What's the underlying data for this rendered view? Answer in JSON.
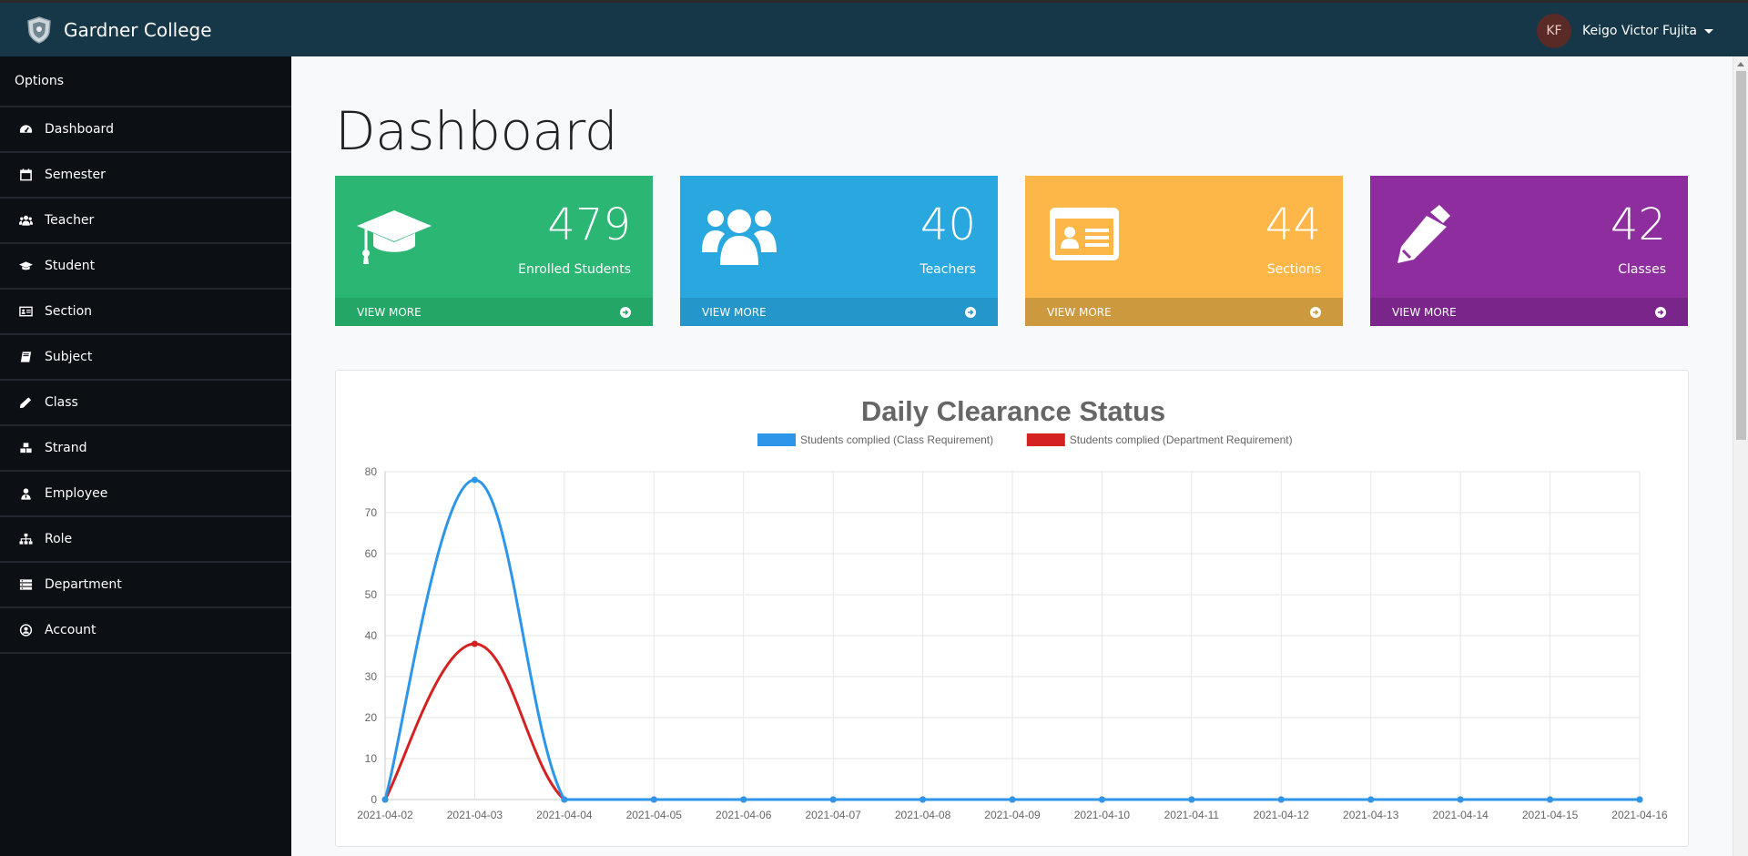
{
  "app": {
    "brand": "Gardner College",
    "logo_icon": "shield-crest-icon"
  },
  "user": {
    "initials": "KF",
    "name": "Keigo Victor Fujita"
  },
  "sidebar": {
    "title": "Options",
    "items": [
      {
        "label": "Dashboard",
        "icon": "tachometer-icon"
      },
      {
        "label": "Semester",
        "icon": "calendar-icon"
      },
      {
        "label": "Teacher",
        "icon": "users-icon"
      },
      {
        "label": "Student",
        "icon": "graduation-cap-icon"
      },
      {
        "label": "Section",
        "icon": "id-card-icon"
      },
      {
        "label": "Subject",
        "icon": "book-icon"
      },
      {
        "label": "Class",
        "icon": "pencil-icon"
      },
      {
        "label": "Strand",
        "icon": "cubes-icon"
      },
      {
        "label": "Employee",
        "icon": "user-tie-icon"
      },
      {
        "label": "Role",
        "icon": "sitemap-icon"
      },
      {
        "label": "Department",
        "icon": "server-icon"
      },
      {
        "label": "Account",
        "icon": "user-circle-icon"
      }
    ]
  },
  "page": {
    "title": "Dashboard"
  },
  "cards": [
    {
      "count": "479",
      "label": "Enrolled Students",
      "footer": "VIEW MORE",
      "color": "#2bb673",
      "footer_color": "#24a766",
      "icon": "graduation-cap-icon"
    },
    {
      "count": "40",
      "label": "Teachers",
      "footer": "VIEW MORE",
      "color": "#29a8e0",
      "footer_color": "#2496c9",
      "icon": "users-icon"
    },
    {
      "count": "44",
      "label": "Sections",
      "footer": "VIEW MORE",
      "color": "#fdb748",
      "footer_color": "#cc993f",
      "icon": "id-card-icon"
    },
    {
      "count": "42",
      "label": "Classes",
      "footer": "VIEW MORE",
      "color": "#8e2d9e",
      "footer_color": "#7a2589",
      "icon": "pencil-icon"
    }
  ],
  "chart_data": {
    "type": "line",
    "title": "Daily Clearance Status",
    "x": [
      "2021-04-02",
      "2021-04-03",
      "2021-04-04",
      "2021-04-05",
      "2021-04-06",
      "2021-04-07",
      "2021-04-08",
      "2021-04-09",
      "2021-04-10",
      "2021-04-11",
      "2021-04-12",
      "2021-04-13",
      "2021-04-14",
      "2021-04-15",
      "2021-04-16"
    ],
    "series": [
      {
        "name": "Students complied (Class Requirement)",
        "color": "#2d96e8",
        "values": [
          0,
          78,
          0,
          0,
          0,
          0,
          0,
          0,
          0,
          0,
          0,
          0,
          0,
          0,
          0
        ]
      },
      {
        "name": "Students complied (Department Requirement)",
        "color": "#d42222",
        "values": [
          0,
          38,
          0,
          0,
          0,
          0,
          0,
          0,
          0,
          0,
          0,
          0,
          0,
          0,
          0
        ]
      }
    ],
    "ylim": [
      0,
      80
    ],
    "yticks": [
      0,
      10,
      20,
      30,
      40,
      50,
      60,
      70,
      80
    ],
    "grid": true,
    "legend": "top"
  }
}
